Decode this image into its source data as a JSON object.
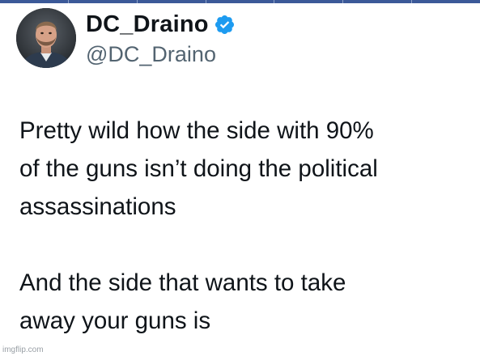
{
  "tweet": {
    "display_name": "DC_Draino",
    "handle": "@DC_Draino",
    "verified_icon": "verified-badge-icon",
    "avatar_icon": "profile-photo",
    "text_paragraph_1": "Pretty wild how the side with 90%\nof the guns isn’t doing the political\nassassinations",
    "text_paragraph_2": "And the side that wants to take\naway your guns is"
  },
  "watermark": {
    "text": "imgflip.com"
  },
  "colors": {
    "text": "#0f1419",
    "handle": "#536471",
    "verified": "#1d9bf0",
    "top_strip": "#3b5998"
  }
}
